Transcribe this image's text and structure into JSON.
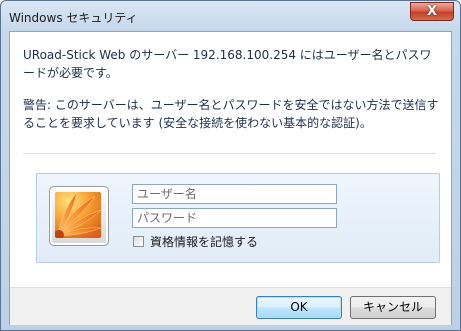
{
  "window": {
    "title": "Windows セキュリティ",
    "close_label": "X"
  },
  "message": {
    "prompt": "URoad-Stick Web のサーバー 192.168.100.254 にはユーザー名とパスワードが必要です。",
    "warning": "警告: このサーバーは、ユーザー名とパスワードを安全ではない方法で送信することを要求しています (安全な接続を使わない基本的な認証)。"
  },
  "credentials": {
    "username_placeholder": "ユーザー名",
    "password_placeholder": "パスワード",
    "remember_label": "資格情報を記憶する",
    "remember_checked": false
  },
  "buttons": {
    "ok_label": "OK",
    "cancel_label": "キャンセル"
  },
  "colors": {
    "title_bar": "#c6d8ec",
    "close_button": "#c4402a",
    "credential_panel": "#e1ecf8",
    "default_button_border": "#3c7fb1",
    "message_text": "#1f2f4f"
  }
}
